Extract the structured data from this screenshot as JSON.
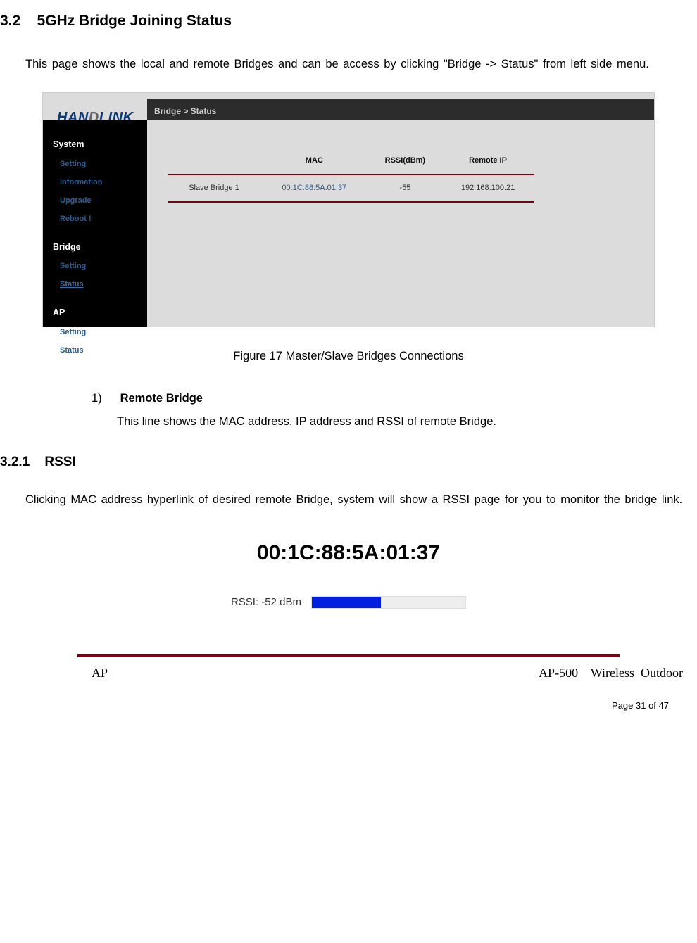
{
  "section": {
    "num": "3.2",
    "title": "5GHz Bridge Joining Status",
    "intro": "This page shows the local and remote Bridges and can be access by clicking \"Bridge -> Status\" from left side menu."
  },
  "screenshot": {
    "logo": {
      "pre": "HAN",
      "d": "D",
      "post": "LINK"
    },
    "breadcrumb": "Bridge > Status",
    "sidebar": {
      "groups": [
        {
          "label": "System",
          "items": [
            "Setting",
            "Information",
            "Upgrade",
            "Reboot !"
          ],
          "active": null
        },
        {
          "label": "Bridge",
          "items": [
            "Setting",
            "Status"
          ],
          "active": "Status"
        },
        {
          "label": "AP",
          "items": [
            "Setting",
            "Status"
          ],
          "active": null
        }
      ]
    },
    "table": {
      "headers": [
        "",
        "MAC",
        "RSSI(dBm)",
        "Remote IP"
      ],
      "rows": [
        {
          "label": "Slave Bridge 1",
          "mac": "00:1C:88:5A:01:37",
          "rssi": "-55",
          "ip": "192.168.100.21"
        }
      ]
    }
  },
  "figcaption": "Figure 17    Master/Slave Bridges Connections",
  "list": {
    "num": "1)",
    "title": "Remote Bridge",
    "body": "This line shows the MAC address, IP address and RSSI of remote Bridge."
  },
  "subsection": {
    "num": "3.2.1",
    "title": "RSSI",
    "body": "Clicking MAC address hyperlink of desired remote Bridge, system will show a RSSI page for you to monitor the bridge link."
  },
  "rssi_fig": {
    "mac": "00:1C:88:5A:01:37",
    "label": "RSSI: -52 dBm"
  },
  "footer": {
    "left": "AP",
    "right": "AP-500    Wireless  Outdoor",
    "pagenum": "Page 31 of 47"
  }
}
